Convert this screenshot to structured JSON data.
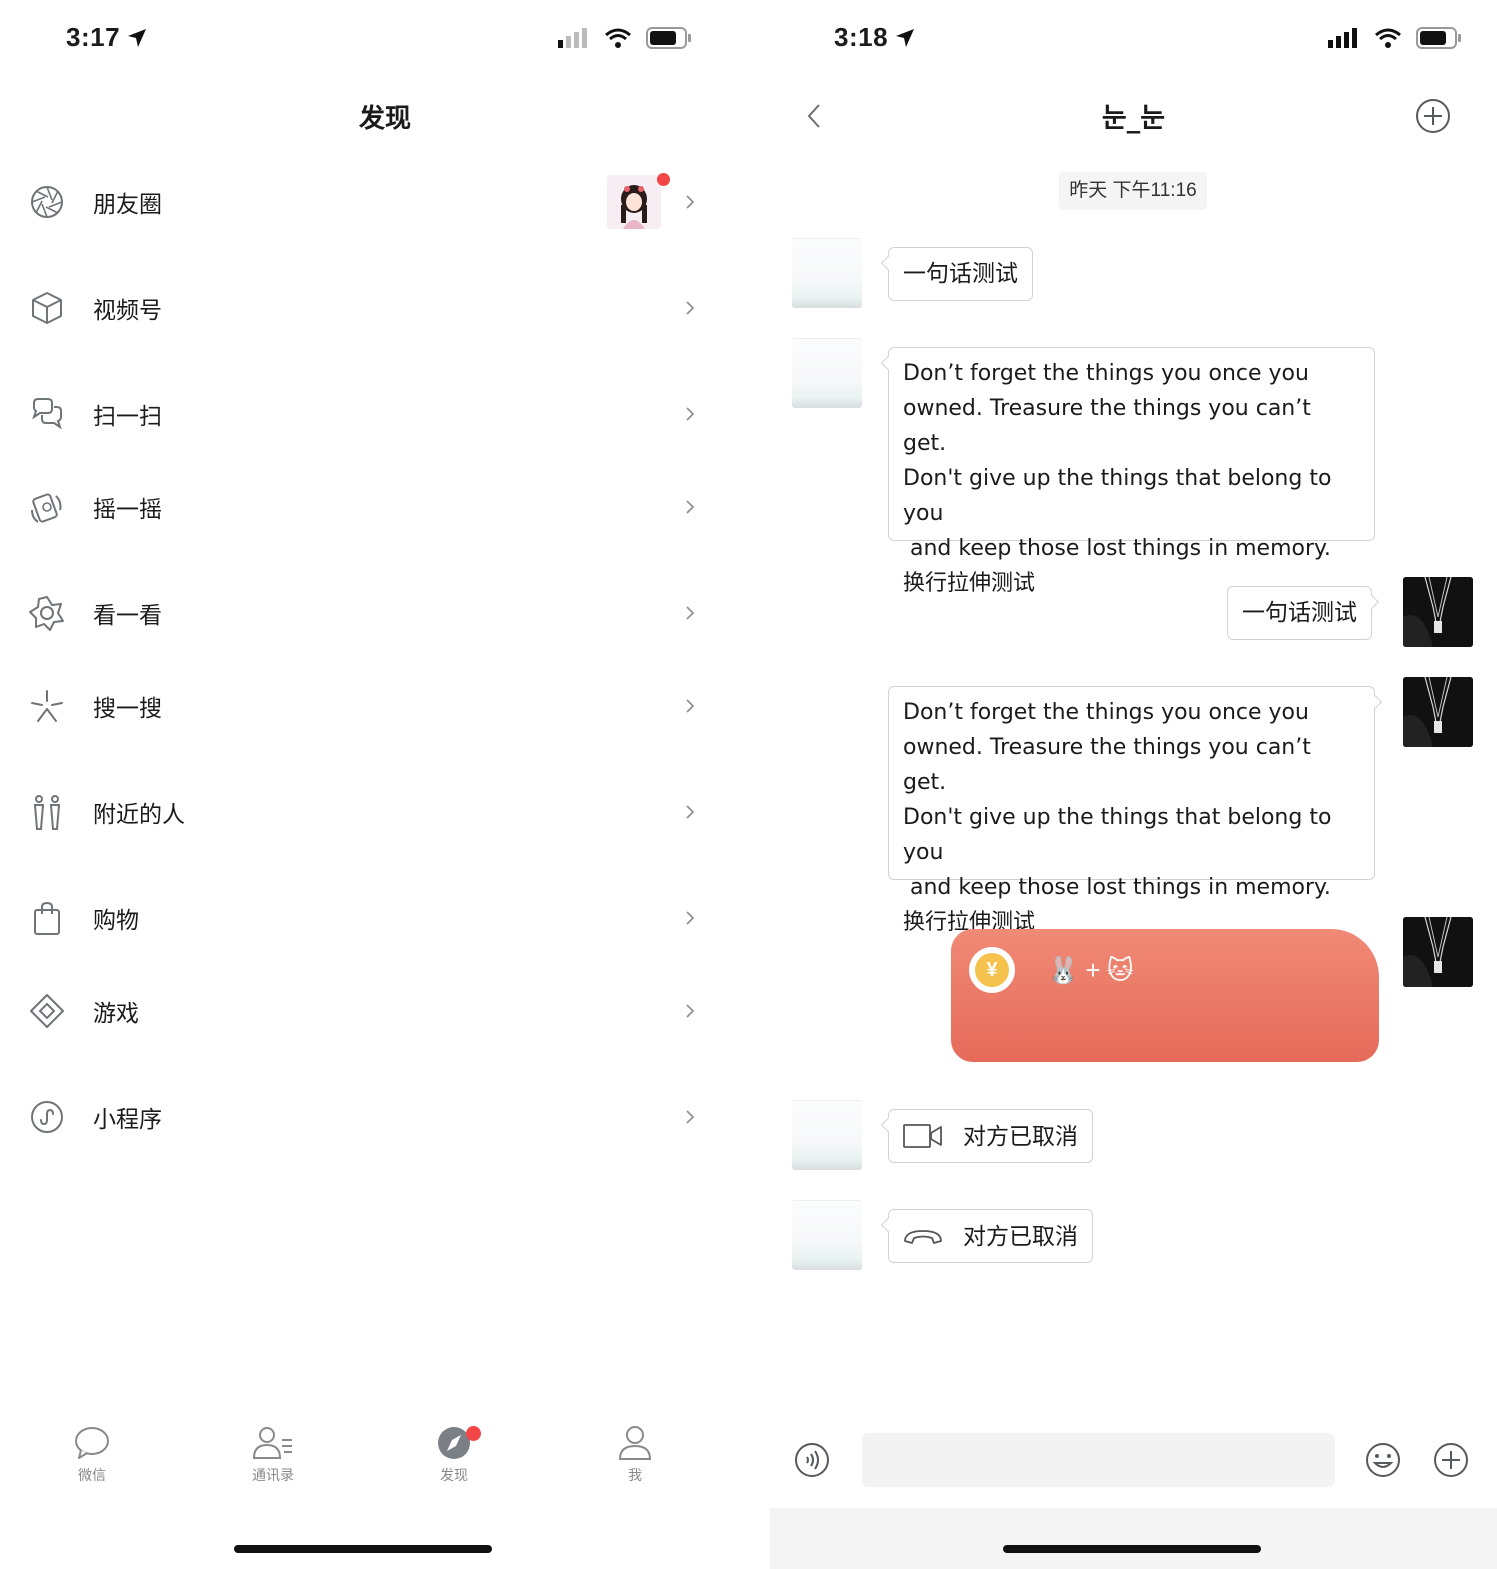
{
  "left": {
    "status_time": "3:17",
    "title": "发现",
    "menu": [
      {
        "id": "moments",
        "label": "朋友圈",
        "icon": "aperture-icon"
      },
      {
        "id": "channels",
        "label": "视频号",
        "icon": "cube-icon"
      },
      {
        "id": "scan",
        "label": "扫一扫",
        "icon": "scan-icon"
      },
      {
        "id": "shake",
        "label": "摇一摇",
        "icon": "shake-icon"
      },
      {
        "id": "top-stories",
        "label": "看一看",
        "icon": "star-flower-icon"
      },
      {
        "id": "search",
        "label": "搜一搜",
        "icon": "sparkle-search-icon"
      },
      {
        "id": "nearby",
        "label": "附近的人",
        "icon": "people-icon"
      },
      {
        "id": "shopping",
        "label": "购物",
        "icon": "shopping-bag-icon"
      },
      {
        "id": "games",
        "label": "游戏",
        "icon": "diamond-game-icon"
      },
      {
        "id": "mini-programs",
        "label": "小程序",
        "icon": "mini-program-icon"
      }
    ],
    "tabs": [
      {
        "label": "微信",
        "icon": "chat-bubble-icon"
      },
      {
        "label": "通讯录",
        "icon": "contacts-icon"
      },
      {
        "label": "发现",
        "icon": "compass-icon"
      },
      {
        "label": "我",
        "icon": "person-icon"
      }
    ]
  },
  "right": {
    "status_time": "3:18",
    "title": "눈_눈",
    "timestamp": "昨天 下午11:16",
    "messages": {
      "m1": "一句话测试",
      "m2_lines": [
        "Don’t forget the things you once you",
        "owned. Treasure the things you can’t get.",
        "Don't give up the things that belong to you",
        " and keep those lost things in memory.",
        "换行拉伸测试"
      ],
      "m3": "一句话测试",
      "m4_lines": [
        "Don’t forget the things you once you",
        "owned. Treasure the things you can’t get.",
        "Don't give up the things that belong to you",
        " and keep those lost things in memory.",
        "换行拉伸测试"
      ],
      "red_packet": {
        "coin": "¥",
        "text_left": "🐰",
        "plus": "+",
        "text_right": "🐱"
      },
      "video_call": "对方已取消",
      "voice_call": "对方已取消"
    }
  },
  "colors": {
    "accent_red": "#f24545",
    "red_packet": "#e8705f",
    "icon_gray": "#6f7479"
  }
}
